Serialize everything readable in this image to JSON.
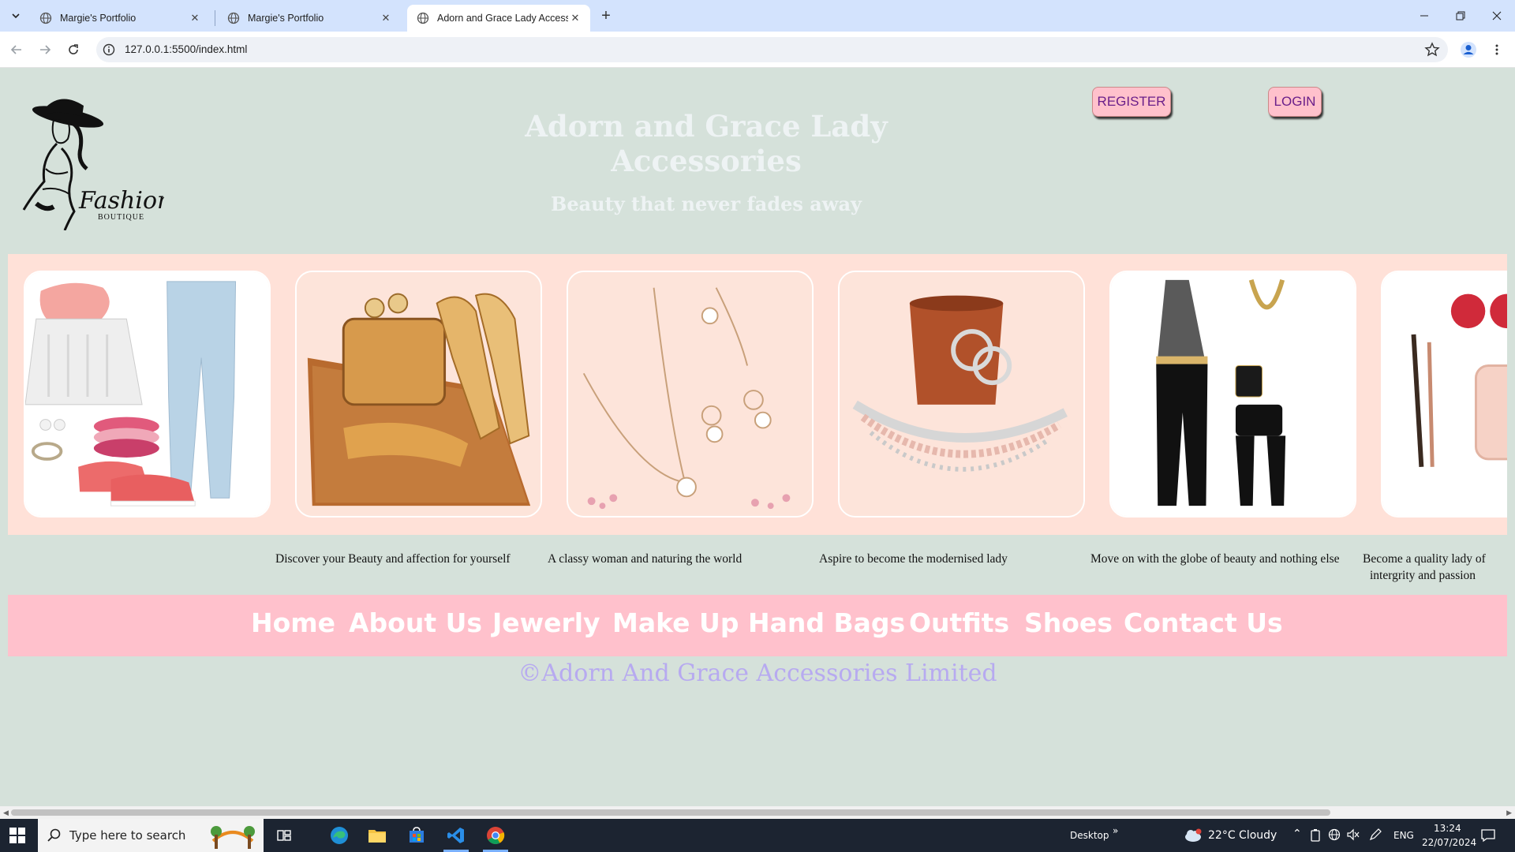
{
  "browser": {
    "tabs": [
      {
        "title": "Margie's Portfolio",
        "active": false
      },
      {
        "title": "Margie's Portfolio",
        "active": false
      },
      {
        "title": "Adorn and Grace Lady Accesso",
        "active": true
      }
    ],
    "url": "127.0.0.1:5500/index.html"
  },
  "header": {
    "logo_text": "Fashion",
    "logo_subtext": "BOUTIQUE",
    "title": "Adorn and Grace Lady Accessories",
    "tagline": "Beauty that never fades away",
    "register_label": "REGISTER",
    "login_label": "LOGIN"
  },
  "gallery": {
    "cards": [
      "outfit-collage",
      "gold-clutch-and-shoes",
      "pendant-jewelry-set",
      "bridal-jewelry-set",
      "black-jumpsuit-set",
      "makeup-and-sunglasses"
    ],
    "captions": [
      "Discover your Beauty and affection for yourself",
      "A classy woman and naturing the world",
      "Aspire to become the modernised lady",
      "Move on with the globe of beauty and nothing else",
      "Become a quality lady of",
      "intergrity and passion"
    ]
  },
  "nav": {
    "items": [
      "Home",
      "About Us",
      "Jewerly",
      "Make Up",
      "Hand Bags",
      "Outfits",
      "Shoes",
      "Contact Us"
    ]
  },
  "footer": {
    "copyright": "©Adorn And Grace Accessories Limited"
  },
  "taskbar": {
    "search_placeholder": "Type here to search",
    "desktop_label": "Desktop",
    "weather": "22°C  Cloudy",
    "language": "ENG",
    "time": "13:24",
    "date": "22/07/2024"
  },
  "colors": {
    "page_bg": "#d5e1da",
    "gallery_bg": "#ffe1d8",
    "nav_bg": "#ffc1cc",
    "button_bg": "#ffc1cc",
    "button_text": "#6a1f8a",
    "copyright": "#b7aaf0"
  }
}
